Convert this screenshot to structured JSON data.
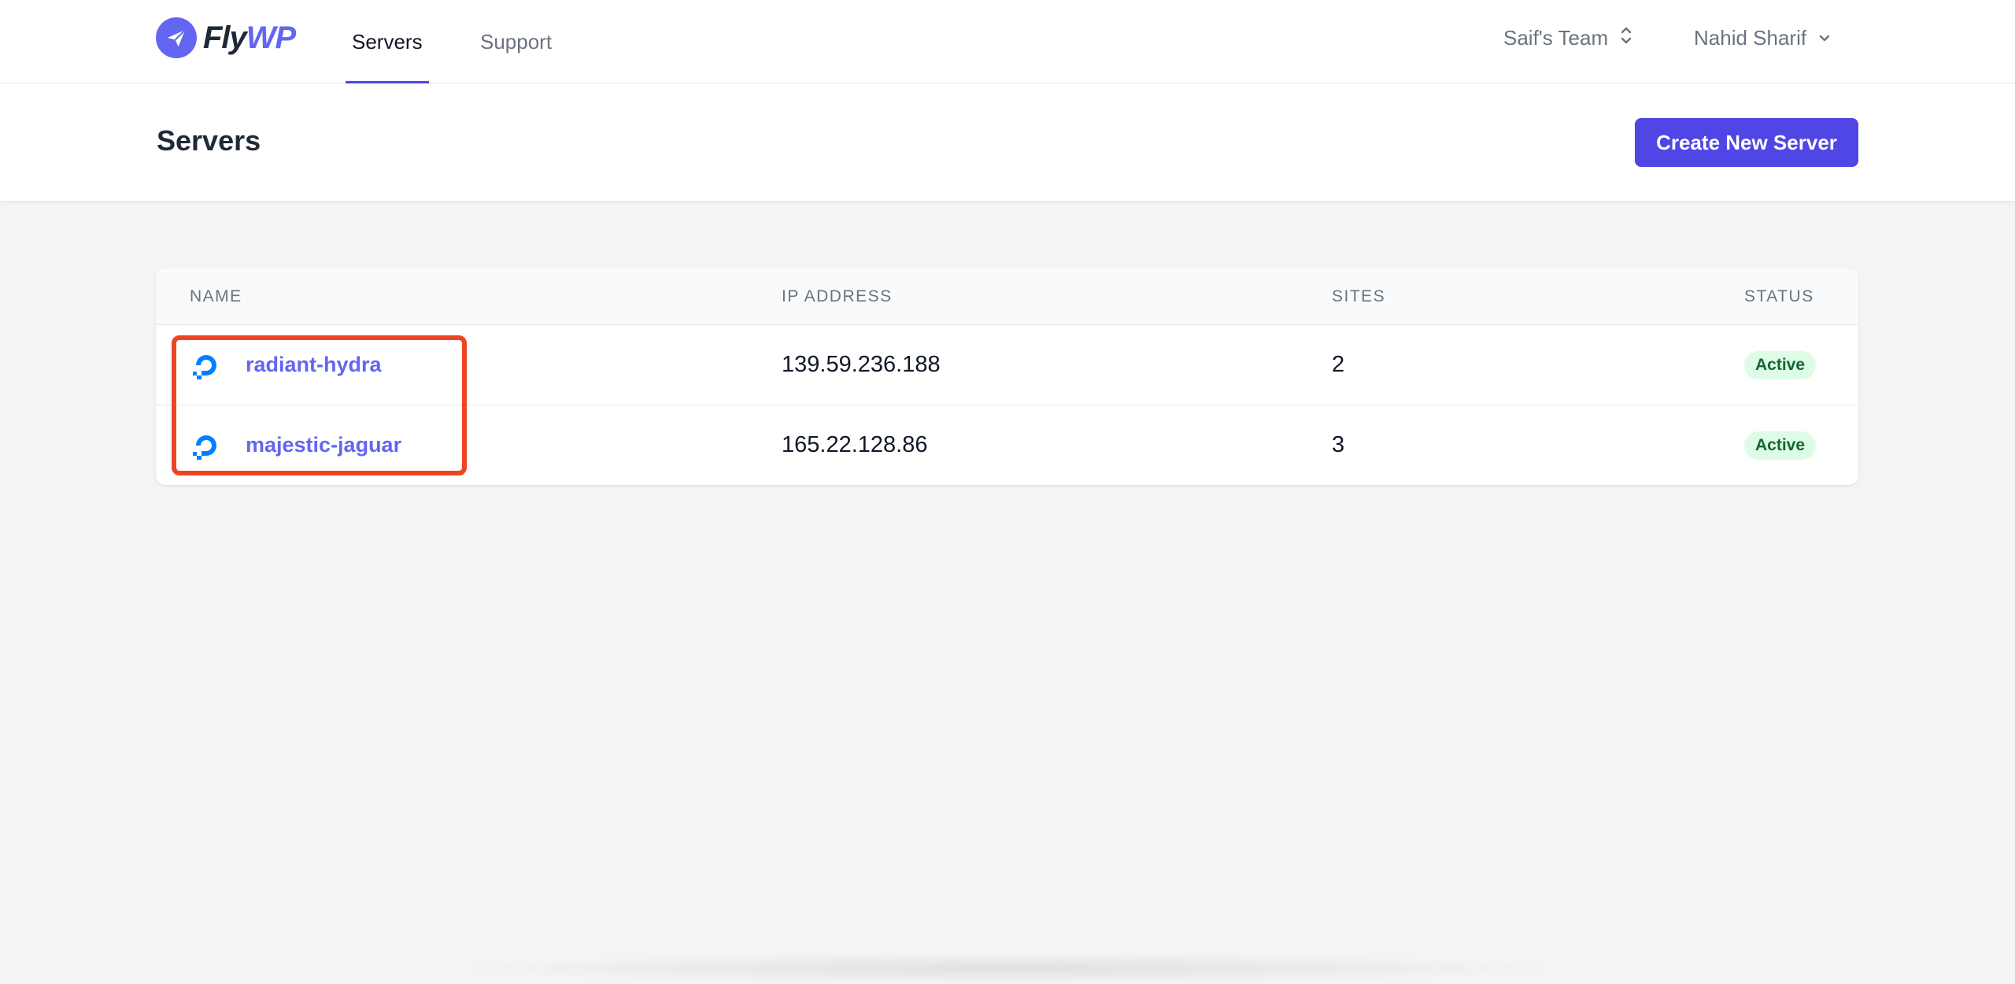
{
  "brand": {
    "logo_text_main": "Fly",
    "logo_text_accent": "WP"
  },
  "nav": {
    "links": [
      {
        "label": "Servers",
        "active": true
      },
      {
        "label": "Support",
        "active": false
      }
    ],
    "team": "Saif's Team",
    "user": "Nahid Sharif"
  },
  "page": {
    "title": "Servers",
    "create_button": "Create New Server"
  },
  "table": {
    "columns": [
      "NAME",
      "IP ADDRESS",
      "SITES",
      "STATUS"
    ],
    "rows": [
      {
        "name": "radiant-hydra",
        "ip": "139.59.236.188",
        "sites": "2",
        "status": "Active"
      },
      {
        "name": "majestic-jaguar",
        "ip": "165.22.128.86",
        "sites": "3",
        "status": "Active"
      }
    ]
  },
  "colors": {
    "accent": "#4f46e5",
    "link": "#6366f1",
    "status_active_bg": "#dcfce7",
    "status_active_text": "#166534",
    "annotation": "#ef4423",
    "provider_icon": "#0080ff"
  },
  "icons": {
    "logo": "paper-plane-icon",
    "team_toggle": "chevron-up-down-icon",
    "user_toggle": "chevron-down-icon",
    "server_provider": "digitalocean-icon"
  }
}
